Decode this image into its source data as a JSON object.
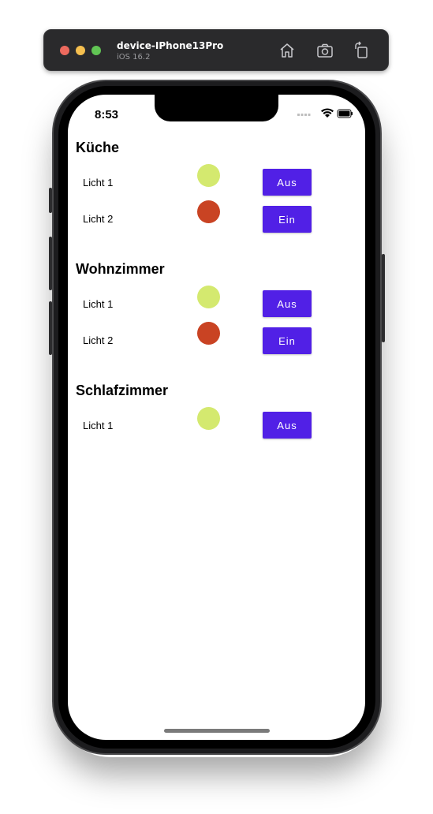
{
  "simulator": {
    "device_name": "device-IPhone13Pro",
    "os_version": "iOS 16.2",
    "icons": [
      "home-icon",
      "screenshot-icon",
      "rotate-icon"
    ]
  },
  "status_bar": {
    "time": "8:53"
  },
  "colors": {
    "on": "#d4e96f",
    "off": "#c94323",
    "button": "#5120e6"
  },
  "rooms": [
    {
      "name": "Küche",
      "lights": [
        {
          "label": "Licht 1",
          "state": "on",
          "button": "Aus"
        },
        {
          "label": "Licht 2",
          "state": "off",
          "button": "Ein"
        }
      ]
    },
    {
      "name": "Wohnzimmer",
      "lights": [
        {
          "label": "Licht 1",
          "state": "on",
          "button": "Aus"
        },
        {
          "label": "Licht 2",
          "state": "off",
          "button": "Ein"
        }
      ]
    },
    {
      "name": "Schlafzimmer",
      "lights": [
        {
          "label": "Licht 1",
          "state": "on",
          "button": "Aus"
        }
      ]
    }
  ]
}
